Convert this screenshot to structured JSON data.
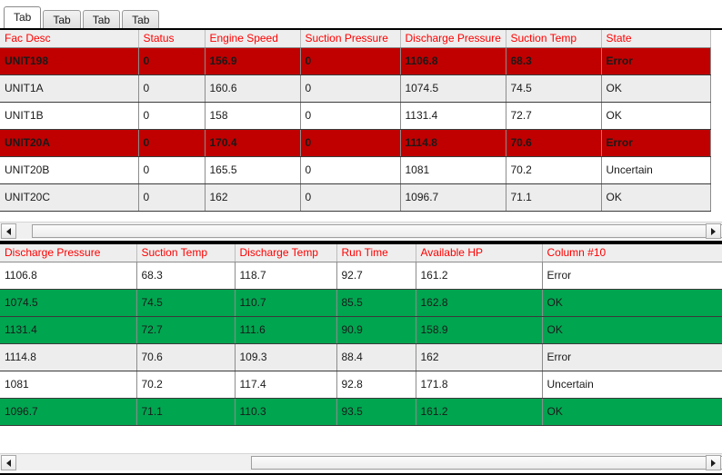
{
  "tabs": [
    {
      "label": "Tab",
      "selected": true
    },
    {
      "label": "Tab",
      "selected": false
    },
    {
      "label": "Tab",
      "selected": false
    },
    {
      "label": "Tab",
      "selected": false
    }
  ],
  "colors": {
    "header_text": "#ff0000",
    "error_row_bg": "#c00000",
    "ok_row_bg": "#00a550",
    "alt_row_bg": "#ededed",
    "row_bg": "#ffffff"
  },
  "top_grid": {
    "columns": [
      "Fac Desc",
      "Status",
      "Engine Speed",
      "Suction Pressure",
      "Discharge Pressure",
      "Suction Temp",
      "State"
    ],
    "rows": [
      {
        "style": "error",
        "cells": [
          "UNIT198",
          "0",
          "156.9",
          "0",
          "1106.8",
          "68.3",
          "Error"
        ]
      },
      {
        "style": "alt",
        "cells": [
          "UNIT1A",
          "0",
          "160.6",
          "0",
          "1074.5",
          "74.5",
          "OK"
        ]
      },
      {
        "style": "white",
        "cells": [
          "UNIT1B",
          "0",
          "158",
          "0",
          "1131.4",
          "72.7",
          "OK"
        ]
      },
      {
        "style": "error",
        "cells": [
          "UNIT20A",
          "0",
          "170.4",
          "0",
          "1114.8",
          "70.6",
          "Error"
        ]
      },
      {
        "style": "white",
        "cells": [
          "UNIT20B",
          "0",
          "165.5",
          "0",
          "1081",
          "70.2",
          "Uncertain"
        ]
      },
      {
        "style": "alt",
        "cells": [
          "UNIT20C",
          "0",
          "162",
          "0",
          "1096.7",
          "71.1",
          "OK"
        ]
      }
    ]
  },
  "bottom_grid": {
    "columns": [
      "Discharge Pressure",
      "Suction Temp",
      "Discharge Temp",
      "Run Time",
      "Available HP",
      "Column #10"
    ],
    "rows": [
      {
        "style": "white",
        "cells": [
          "1106.8",
          "68.3",
          "118.7",
          "92.7",
          "161.2",
          "Error"
        ]
      },
      {
        "style": "ok",
        "cells": [
          "1074.5",
          "74.5",
          "110.7",
          "85.5",
          "162.8",
          "OK"
        ]
      },
      {
        "style": "ok",
        "cells": [
          "1131.4",
          "72.7",
          "111.6",
          "90.9",
          "158.9",
          "OK"
        ]
      },
      {
        "style": "alt",
        "cells": [
          "1114.8",
          "70.6",
          "109.3",
          "88.4",
          "162",
          "Error"
        ]
      },
      {
        "style": "white",
        "cells": [
          "1081",
          "70.2",
          "117.4",
          "92.8",
          "171.8",
          "Uncertain"
        ]
      },
      {
        "style": "ok",
        "cells": [
          "1096.7",
          "71.1",
          "110.3",
          "93.5",
          "161.2",
          "OK"
        ]
      }
    ]
  },
  "top_scrollbar": {
    "left_arrow": "scroll-left-arrow",
    "right_arrow": "scroll-right-arrow",
    "thumb_left_pct": 2.4,
    "thumb_width_pct": 102.0
  },
  "bottom_scrollbar": {
    "left_arrow": "scroll-left-arrow",
    "right_arrow": "scroll-right-arrow",
    "thumb_left_pct": 37.8,
    "thumb_width_pct": 94.0
  }
}
